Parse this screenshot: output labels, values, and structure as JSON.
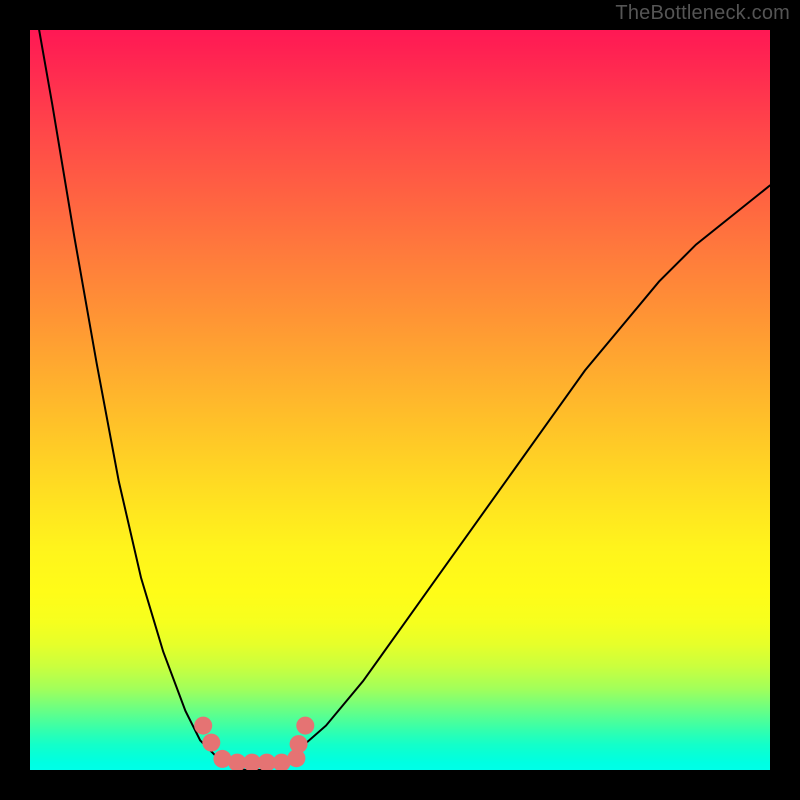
{
  "watermark": "TheBottleneck.com",
  "chart_data": {
    "type": "line",
    "title": "",
    "xlabel": "",
    "ylabel": "",
    "x": [
      0.0,
      0.03,
      0.06,
      0.09,
      0.12,
      0.15,
      0.18,
      0.21,
      0.23,
      0.25,
      0.27,
      0.28,
      0.29,
      0.3,
      0.31,
      0.32,
      0.33,
      0.34,
      0.36,
      0.4,
      0.45,
      0.5,
      0.55,
      0.6,
      0.65,
      0.7,
      0.75,
      0.8,
      0.85,
      0.9,
      0.95,
      1.0
    ],
    "values": [
      1.07,
      0.9,
      0.72,
      0.55,
      0.39,
      0.26,
      0.16,
      0.08,
      0.04,
      0.02,
      0.01,
      0.005,
      0.0,
      0.0,
      0.0,
      0.0,
      0.005,
      0.01,
      0.025,
      0.06,
      0.12,
      0.19,
      0.26,
      0.33,
      0.4,
      0.47,
      0.54,
      0.6,
      0.66,
      0.71,
      0.75,
      0.79
    ],
    "ylim": [
      0,
      1
    ],
    "bottom_markers_x": [
      0.234,
      0.245,
      0.26,
      0.28,
      0.3,
      0.32,
      0.34,
      0.36,
      0.363,
      0.372
    ],
    "bottom_markers_y": [
      0.06,
      0.037,
      0.015,
      0.01,
      0.01,
      0.01,
      0.01,
      0.016,
      0.035,
      0.06
    ],
    "gradient_stops": [
      {
        "pos": 0.0,
        "color": "#ff1854"
      },
      {
        "pos": 0.5,
        "color": "#ffb82c"
      },
      {
        "pos": 0.75,
        "color": "#fffc18"
      },
      {
        "pos": 1.0,
        "color": "#00ffe8"
      }
    ]
  }
}
